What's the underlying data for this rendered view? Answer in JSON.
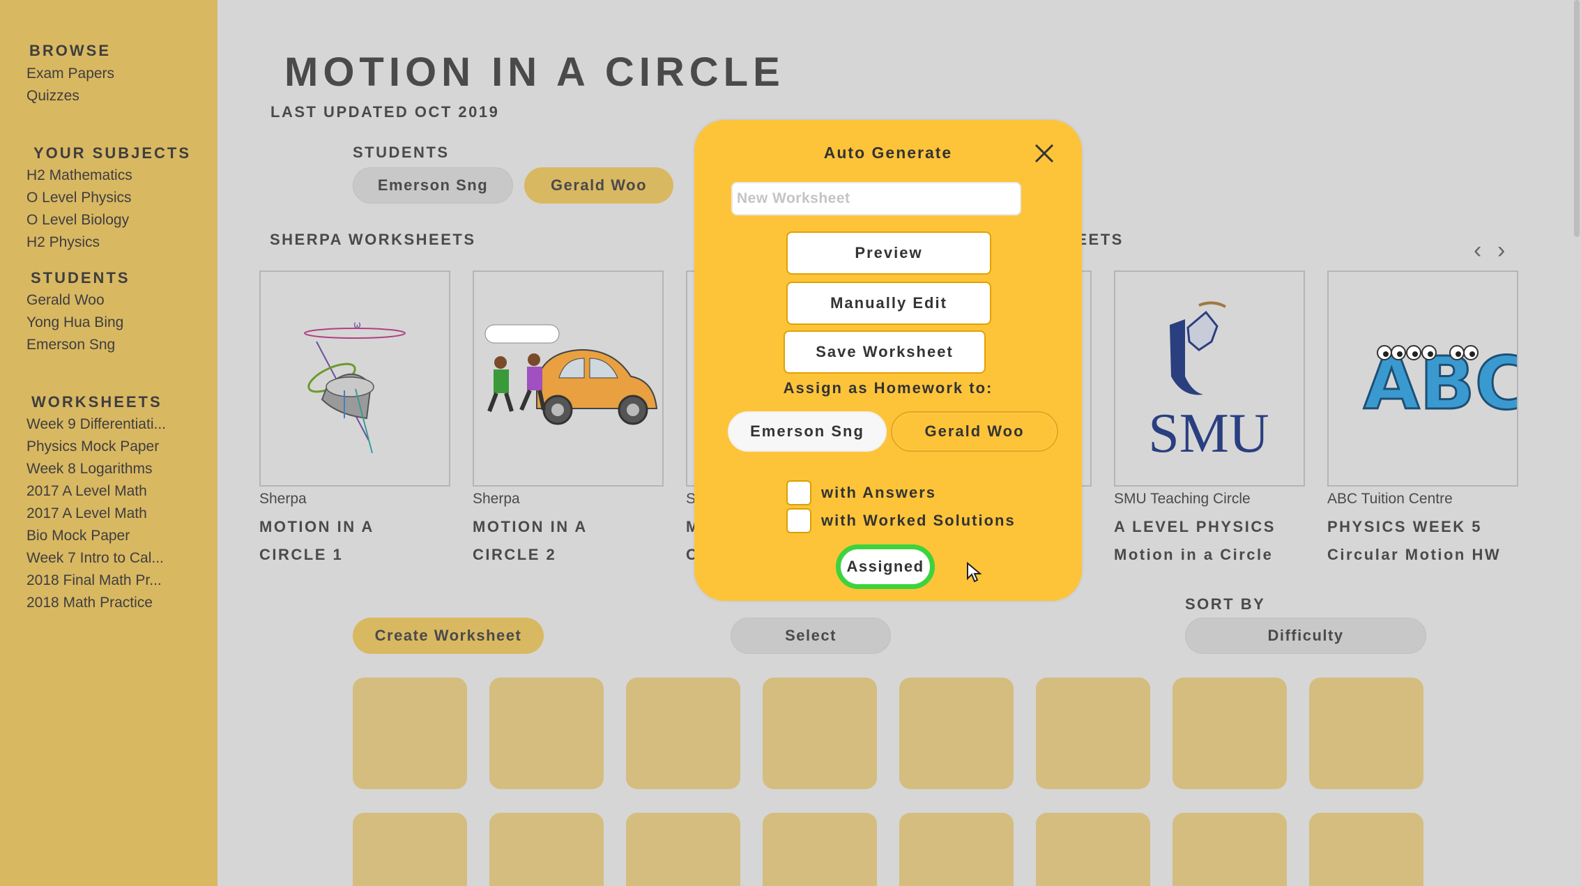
{
  "sidebar": {
    "browse": {
      "heading": "BROWSE",
      "items": [
        "Exam Papers",
        "Quizzes"
      ]
    },
    "subjects": {
      "heading": "YOUR SUBJECTS",
      "items": [
        "H2 Mathematics",
        "O Level Physics",
        "O Level Biology",
        "H2 Physics"
      ]
    },
    "students": {
      "heading": "STUDENTS",
      "items": [
        "Gerald Woo",
        "Yong Hua Bing",
        "Emerson Sng"
      ]
    },
    "worksheets": {
      "heading": "WORKSHEETS",
      "items": [
        "Week 9 Differentiati...",
        "Physics Mock Paper",
        "Week 8 Logarithms",
        "2017 A Level Math",
        "2017 A Level Math",
        "Bio Mock Paper",
        "Week 7 Intro to Cal...",
        "2018 Final Math Pr...",
        "2018 Math Practice"
      ]
    }
  },
  "main": {
    "title": "MOTION IN A CIRCLE",
    "updated": "LAST UPDATED OCT 2019",
    "students_label": "STUDENTS",
    "students": [
      "Emerson Sng",
      "Gerald Woo"
    ],
    "sherpa_label": "SHERPA WORKSHEETS",
    "other_label_partial": "HEETS",
    "cards": [
      {
        "source": "Sherpa",
        "title1": "MOTION IN A",
        "title2": "CIRCLE 1"
      },
      {
        "source": "Sherpa",
        "title1": "MOTION IN A",
        "title2": "CIRCLE 2"
      },
      {
        "source": "S",
        "title1": "M",
        "title2": "C"
      },
      {
        "source": "SMU Teaching Circle",
        "title1": "A LEVEL PHYSICS",
        "title2": "Motion in a Circle"
      },
      {
        "source": "ABC Tuition Centre",
        "title1": "PHYSICS WEEK 5",
        "title2": "Circular Motion HW"
      }
    ],
    "smu_logo_text": "SMU",
    "abc_logo_text": "ABC",
    "create_button": "Create Worksheet",
    "select_button": "Select",
    "sort_label": "SORT BY",
    "sort_value": "Difficulty"
  },
  "modal": {
    "title": "Auto Generate",
    "input_placeholder": "New Worksheet",
    "preview": "Preview",
    "manual_edit": "Manually Edit",
    "save": "Save Worksheet",
    "assign_label": "Assign as Homework to:",
    "students": [
      "Emerson Sng",
      "Gerald Woo"
    ],
    "with_answers": "with Answers",
    "with_solutions": "with Worked Solutions",
    "assigned": "Assigned"
  },
  "colors": {
    "sidebar": "#d9b862",
    "modal": "#fdc43a",
    "assigned_ring": "#3dd33d",
    "tile": "#d4bd7f"
  }
}
